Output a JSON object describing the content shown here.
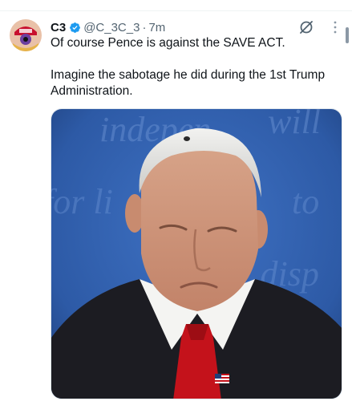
{
  "tweet": {
    "author_name": "C3",
    "handle": "@C_3C_3",
    "separator": "·",
    "time": "7m",
    "text_line1": "Of course Pence is against the SAVE ACT.",
    "text_line2": "Imagine the sabotage he did during the 1st Trump Administration."
  },
  "photo_background_text": [
    "indepen",
    "will",
    "for li",
    "to",
    "e disp"
  ],
  "colors": {
    "verified": "#1d9bf0",
    "secondary_text": "#536471",
    "primary_text": "#0f1419",
    "photo_background": "#2d5aa6"
  },
  "icons": {
    "verified": "verified-badge-icon",
    "grok": "grok-icon",
    "more": "more-options-icon"
  }
}
